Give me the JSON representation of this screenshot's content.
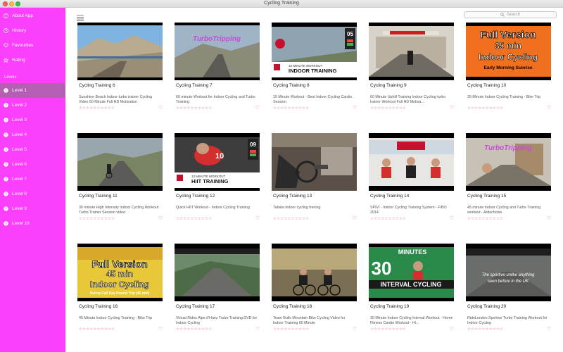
{
  "window": {
    "title": "Cycling Training"
  },
  "sidebar": {
    "top_items": [
      {
        "label": "About App",
        "icon": "info-icon"
      },
      {
        "label": "History",
        "icon": "clock-icon"
      },
      {
        "label": "Favourites",
        "icon": "heart-icon"
      },
      {
        "label": "Rating",
        "icon": "star-icon"
      }
    ],
    "levels_heading": "Levels",
    "levels": [
      {
        "label": "Level 1",
        "active": true
      },
      {
        "label": "Level 2"
      },
      {
        "label": "Level 3"
      },
      {
        "label": "Level 4"
      },
      {
        "label": "Level 5"
      },
      {
        "label": "Level 6"
      },
      {
        "label": "Level 7"
      },
      {
        "label": "Level 8"
      },
      {
        "label": "Level 9"
      },
      {
        "label": "Level 10"
      }
    ],
    "colors": {
      "background": "#fc3ffc",
      "active": "#9a9a9a"
    }
  },
  "toolbar": {
    "search_placeholder": "Search"
  },
  "videos": [
    {
      "title": "Cycling Training 6",
      "description": "Sunshine Beach Indoor turbo trainer Cycling Video 60 Minute Full HD Motivation",
      "thumb": "coast"
    },
    {
      "title": "Cycling Training 7",
      "description": "60 minute Workout for Indoor Cycling and Turbo Training",
      "thumb": "turbotripping",
      "overlay": "TurboTripping"
    },
    {
      "title": "Cycling Training 8",
      "description": "15 Minute Workout - Best Indoor Cycling Cardio Session",
      "thumb": "indoor-training",
      "overlay": "15 MINUTE WORKOUT",
      "overlay2": "INDOOR TRAINING",
      "counter": "05"
    },
    {
      "title": "Cycling Training 9",
      "description": "60 Minute Uphill Training Indoor Cycling turbo trainer Workout Full HD Motiva...",
      "thumb": "gate"
    },
    {
      "title": "Cycling Training 10",
      "description": "35 Minute Indoor Cycling Training - Bike Trip",
      "thumb": "fullversion-orange",
      "overlay": "Full Version",
      "overlay2": "35 min",
      "overlay3": "Indoor Cycling",
      "overlay4": "Early Morning Sunrise"
    },
    {
      "title": "Cycling Training 11",
      "description": "30 minute High Intensity Indoor Cycling Workout Turbo Trainer Session video",
      "thumb": "road-rider"
    },
    {
      "title": "Cycling Training 12",
      "description": "Quick HIIT Workout - Indoor Cycling Training",
      "thumb": "hiit",
      "overlay": "13 MINUTE WORKOUT",
      "overlay2": "HIIT TRAINING",
      "counter": "09",
      "counter2": "10"
    },
    {
      "title": "Cycling Training 13",
      "description": "Tabata indoor cycling trening",
      "thumb": "gym"
    },
    {
      "title": "Cycling Training 14",
      "description": "SPIVI - Indoor Cycling Training System - FIBO 2014",
      "thumb": "class"
    },
    {
      "title": "Cycling Training 15",
      "description": "45 minute Indoor Cycling and Turbo Training workout - Ardechoise",
      "thumb": "turbotripping-town",
      "overlay": "TurboTripping"
    },
    {
      "title": "Cycling Training 16",
      "description": "45 Minute Indoor Cycling Training - Bike Trip",
      "thumb": "fullversion-yellow",
      "overlay": "Full Version",
      "overlay2": "45 min",
      "overlay3": "Indoor Cycling",
      "overlay4": "Sunny Full Day Round Trip (45 min)"
    },
    {
      "title": "Cycling Training 17",
      "description": "Virtual Rides Alpe d'Huez Turbo Training DVD for Indoor Cycling",
      "thumb": "alpe"
    },
    {
      "title": "Cycling Training 18",
      "description": "Team Bulls Mountain Bike Cycling Video for Indoor Training 60 Minute",
      "thumb": "mtb"
    },
    {
      "title": "Cycling Training 19",
      "description": "30 Minute Indoor Cycling Interval Workout - Home Fitness Cardio Workout - Hi...",
      "thumb": "interval",
      "overlay": "MINUTES",
      "overlay2": "INTERVAL CYCLING",
      "counter": "30"
    },
    {
      "title": "Cycling Training 20",
      "description": "RideLondon Sportive Turbo Training Workout for Indoor Cycling",
      "thumb": "london",
      "overlay": "The sportive unlike anything",
      "overlay2": "seen before in the UK"
    }
  ],
  "rating_stars": "☆☆☆☆☆☆☆☆☆☆",
  "accent_color": "#f05a7a"
}
